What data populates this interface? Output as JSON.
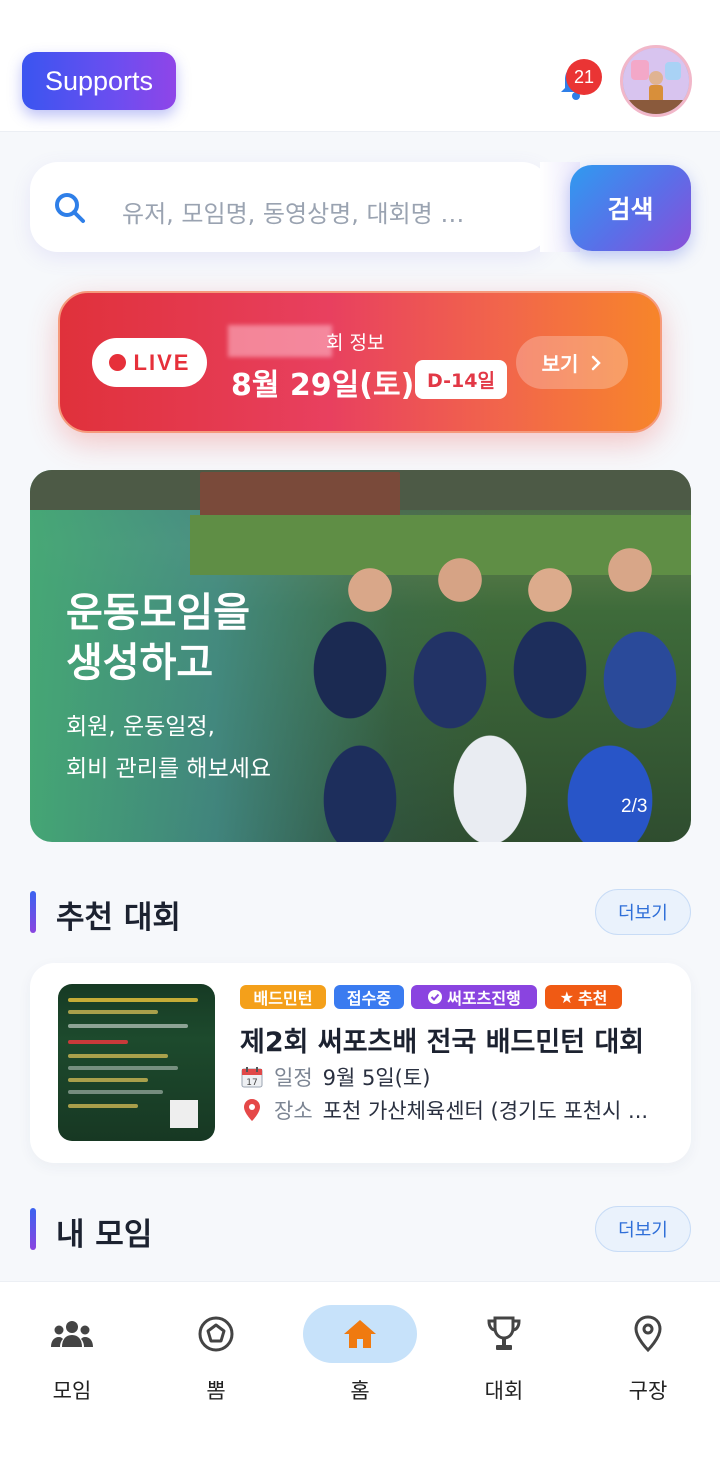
{
  "header": {
    "logo_label": "Supports",
    "notification_count": "21"
  },
  "search": {
    "placeholder": "유저, 모임명, 동영상명, 대회명 …",
    "button_label": "검색"
  },
  "live_card": {
    "live_label": "LIVE",
    "subtitle": "회 정보",
    "date": "8월 29일(토)",
    "dday": "D-14일",
    "view_label": "보기"
  },
  "banner": {
    "title": "운동모임을 생성하고",
    "description": "회원, 운동일정, 회비 관리를 해보세요",
    "counter": "2/3"
  },
  "recommended": {
    "title": "추천 대회",
    "more_label": "더보기",
    "tournament": {
      "tags": [
        {
          "label": "배드민턴",
          "color": "#f4a01a"
        },
        {
          "label": "접수중",
          "color": "#3a7bf0"
        },
        {
          "label": "써포츠진행",
          "color": "#8a44e0"
        },
        {
          "label": "추천",
          "color": "#f05a14"
        }
      ],
      "name": "제2회 써포츠배 전국 배드민턴 대회",
      "schedule_label": "일정",
      "schedule_value": "9월 5일(토)",
      "venue_label": "장소",
      "venue_value": "포천 가산체육센터 (경기도 포천시 ..."
    }
  },
  "my_groups": {
    "title": "내 모임",
    "more_label": "더보기"
  },
  "bottom_nav": {
    "items": [
      {
        "label": "모임",
        "icon": "group-icon"
      },
      {
        "label": "뽐",
        "icon": "soccer-ball-icon"
      },
      {
        "label": "홈",
        "icon": "home-icon"
      },
      {
        "label": "대회",
        "icon": "trophy-icon"
      },
      {
        "label": "구장",
        "icon": "location-pin-icon"
      }
    ],
    "active": "홈"
  },
  "colors": {
    "brand_blue": "#3a55f0",
    "brand_purple": "#8a45e0",
    "live_red": "#e6303a",
    "active_nav_bg": "#c7e2fa",
    "home_icon": "#f07a10"
  }
}
